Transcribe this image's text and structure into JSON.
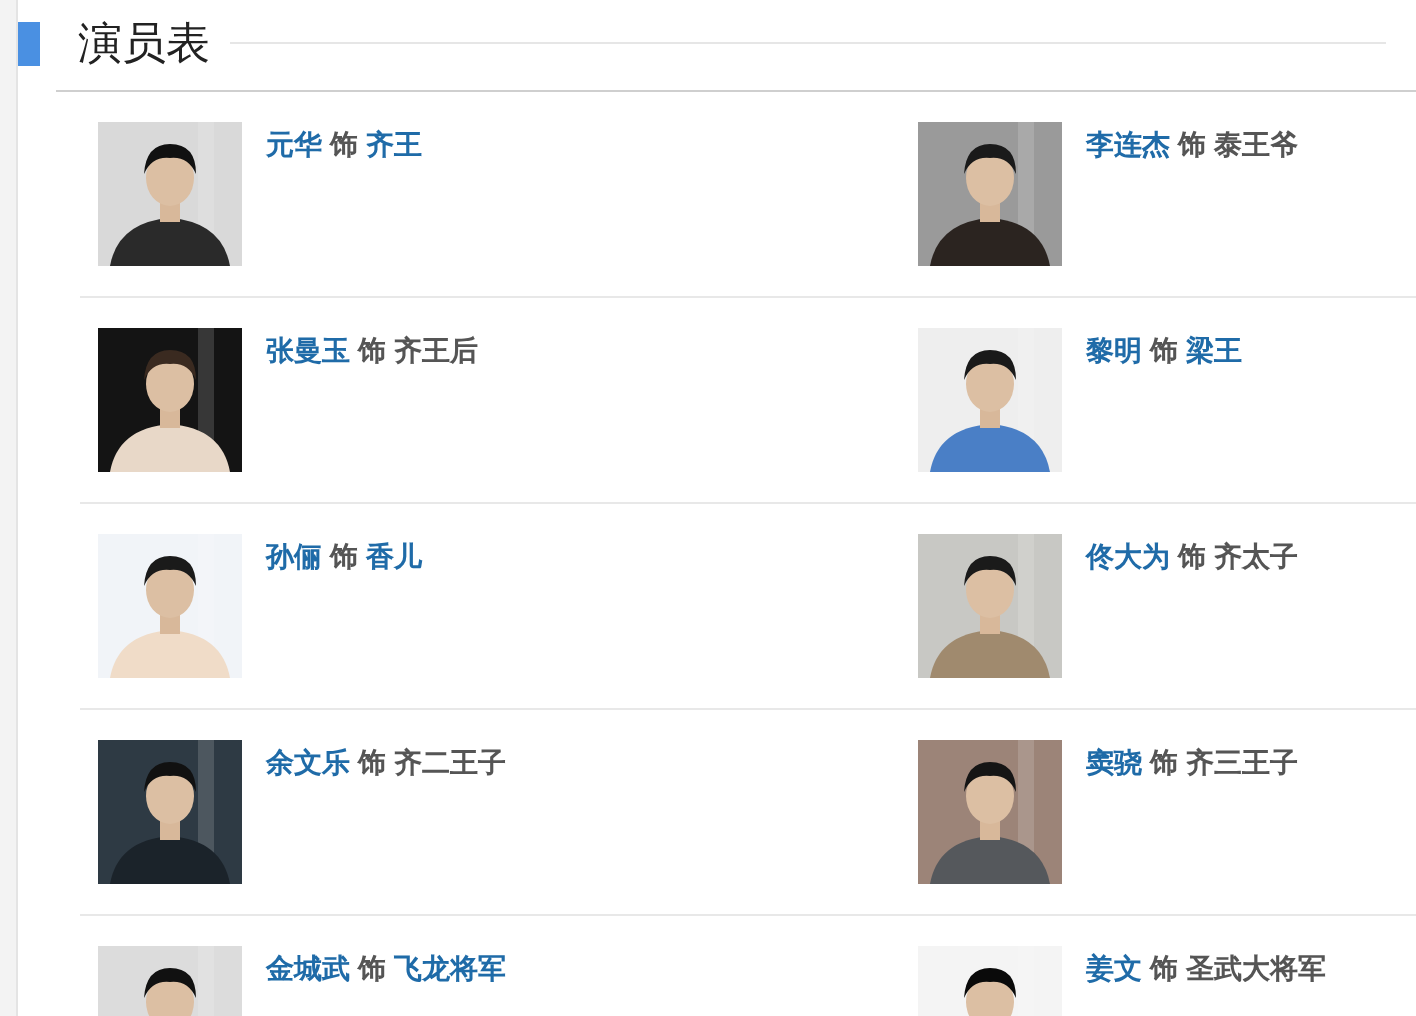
{
  "section": {
    "title": "演员表"
  },
  "cast": [
    {
      "actor": "元华",
      "connector": "饰",
      "role": "齐王",
      "role_linked": true
    },
    {
      "actor": "李连杰",
      "connector": "饰",
      "role": "泰王爷",
      "role_linked": false
    },
    {
      "actor": "张曼玉",
      "connector": "饰",
      "role": "齐王后",
      "role_linked": false
    },
    {
      "actor": "黎明",
      "connector": "饰",
      "role": "梁王",
      "role_linked": true
    },
    {
      "actor": "孙俪",
      "connector": "饰",
      "role": "香儿",
      "role_linked": true
    },
    {
      "actor": "佟大为",
      "connector": "饰",
      "role": "齐太子",
      "role_linked": false
    },
    {
      "actor": "余文乐",
      "connector": "饰",
      "role": "齐二王子",
      "role_linked": false
    },
    {
      "actor": "窦骁",
      "connector": "饰",
      "role": "齐三王子",
      "role_linked": false
    },
    {
      "actor": "金城武",
      "connector": "饰",
      "role": "飞龙将军",
      "role_linked": true
    },
    {
      "actor": "姜文",
      "connector": "饰",
      "role": "圣武大将军",
      "role_linked": false
    }
  ]
}
